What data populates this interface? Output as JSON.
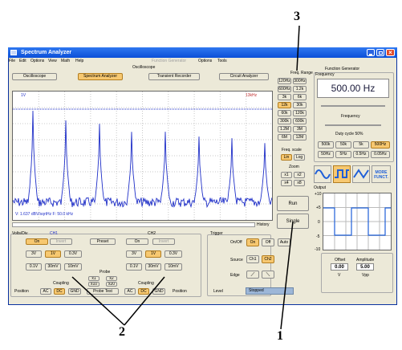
{
  "window": {
    "title": "Spectrum Analyzer"
  },
  "menu": [
    "File",
    "Edit",
    "Options",
    "View",
    "Math",
    "Help"
  ],
  "menu_dim": "Function Generator",
  "menu_right": [
    "Options",
    "Tools"
  ],
  "oscilloscope": {
    "group_label": "Oscilloscope",
    "tabs": [
      "Oscilloscope",
      "Spectrum Analyzer",
      "Transient Recorder",
      "Circuit Analyzer"
    ],
    "active_tab": 1
  },
  "plot": {
    "ch_label": "1V",
    "freq_label": "13kHz",
    "readout": "V: 1.637 dBV/sqrtHz   F: 50.0 kHz",
    "history": "History"
  },
  "freq_range": {
    "label": "Freq. Range",
    "buttons": [
      "120Hz",
      "300Hz",
      "600Hz",
      "1.2k",
      "3k",
      "6k",
      "12k",
      "30k",
      "60k",
      "120k",
      "300k",
      "600k",
      "1.2M",
      "3M",
      "6M",
      "12M"
    ],
    "selected": 6
  },
  "freq_scale": {
    "label": "Freq. scale",
    "lin": "Lin",
    "log": "Log"
  },
  "zoom": {
    "label": "Zoom",
    "buttons": [
      "x1",
      "x2",
      "x4",
      "x8"
    ]
  },
  "run": "Run",
  "single": "Single",
  "volts": {
    "label": "Volts/Div",
    "ch1": "CH1",
    "ch2": "CH2",
    "on": "On",
    "invert": "Invert",
    "preset": "Preset",
    "volts": [
      "3V",
      "1V",
      "0.3V",
      "0.1V",
      "30mV",
      "10mV"
    ],
    "probe_label": "Probe",
    "probe": [
      "x1",
      "x2",
      "x10",
      "x20"
    ],
    "probe_test": "Probe Test",
    "coupling": "Coupling",
    "coup": [
      "AC",
      "DC",
      "GND"
    ],
    "position": "Position"
  },
  "trigger": {
    "label": "Trigger",
    "onoff": "On/Off",
    "on": "On",
    "off": "Off",
    "auto": "Auto",
    "source": "Source",
    "src": [
      "Ch1",
      "Ch2"
    ],
    "edge": "Edge",
    "level": "Level",
    "status": "Stopped"
  },
  "funcgen": {
    "label": "Function Generator",
    "freq_label": "Frequency",
    "freq_value": "500.00 Hz",
    "freq_slider": "Frequency",
    "duty": "Duty cycle 50%",
    "presets": [
      "500k",
      "50k",
      "5k",
      "500Hz",
      "50Hz",
      "5Hz",
      "0.5Hz",
      "0.05Hz"
    ],
    "more": "MORE FUNCT.",
    "output": "Output",
    "yticks": [
      "+10",
      "+5",
      "0",
      "-5",
      "-10"
    ],
    "offset_label": "Offset",
    "offset_value": "0.00",
    "offset_unit": "V",
    "amp_label": "Amplitude",
    "amp_value": "5.00",
    "amp_unit": "Vpp"
  },
  "callouts": [
    "3",
    "2",
    "1"
  ],
  "colors": {
    "title_bar": "#0b4fd8",
    "trace": "#1f2fc8",
    "highlight": "#f7c870",
    "wave_active": "#1f5fd8"
  }
}
